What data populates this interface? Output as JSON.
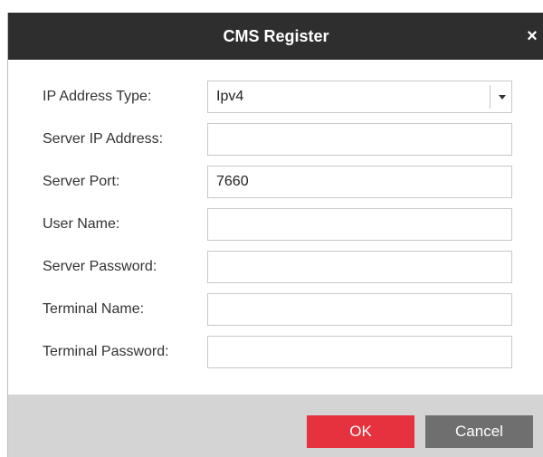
{
  "dialog": {
    "title": "CMS Register",
    "close_label": "×"
  },
  "form": {
    "ip_address_type": {
      "label": "IP Address Type:",
      "value": "Ipv4"
    },
    "server_ip_address": {
      "label": "Server IP Address:",
      "value": ""
    },
    "server_port": {
      "label": "Server Port:",
      "value": "7660"
    },
    "user_name": {
      "label": "User Name:",
      "value": ""
    },
    "server_password": {
      "label": "Server Password:",
      "value": ""
    },
    "terminal_name": {
      "label": "Terminal Name:",
      "value": ""
    },
    "terminal_password": {
      "label": "Terminal Password:",
      "value": ""
    }
  },
  "footer": {
    "ok_label": "OK",
    "cancel_label": "Cancel"
  },
  "colors": {
    "titlebar": "#2e2e2e",
    "ok_button": "#e5323e",
    "cancel_button": "#6f6f6f",
    "footer": "#d4d4d4"
  },
  "icons": {
    "close": "close-icon",
    "dropdown": "chevron-down-icon"
  }
}
